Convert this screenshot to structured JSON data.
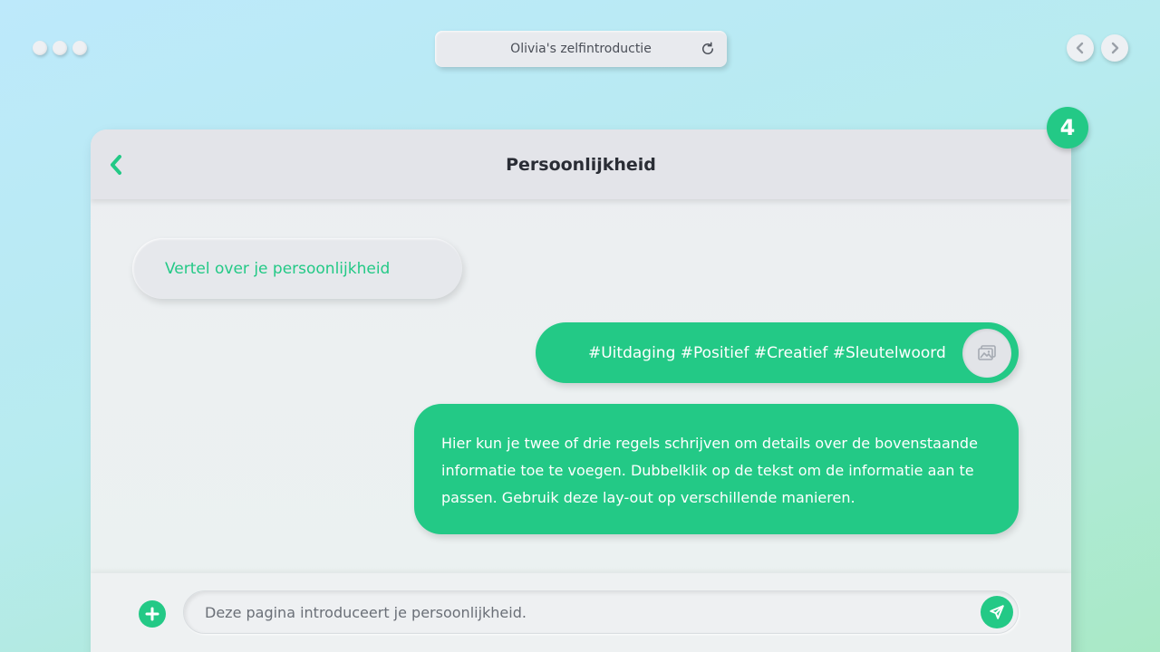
{
  "window": {
    "title": "Olivia's zelfintroductie"
  },
  "card": {
    "header_title": "Persoonlijkheid",
    "badge_number": "4"
  },
  "chat": {
    "incoming_message": "Vertel over je persoonlijkheid",
    "tags_message": "#Uitdaging #Positief #Creatief #Sleutelwoord",
    "long_message": "Hier kun je twee of drie regels schrijven om details over de bovenstaande informatie toe te voegen. Dubbelklik op de tekst om de informatie aan te passen. Gebruik deze lay-out op verschillende manieren."
  },
  "input": {
    "value": "Deze pagina introduceert je persoonlijkheid."
  },
  "colors": {
    "accent": "#23c986",
    "header_bg": "#e3e4e9"
  },
  "icons": {
    "back": "chevron-left-icon",
    "refresh": "refresh-icon",
    "image": "image-icon",
    "add": "plus-icon",
    "send": "send-icon"
  }
}
